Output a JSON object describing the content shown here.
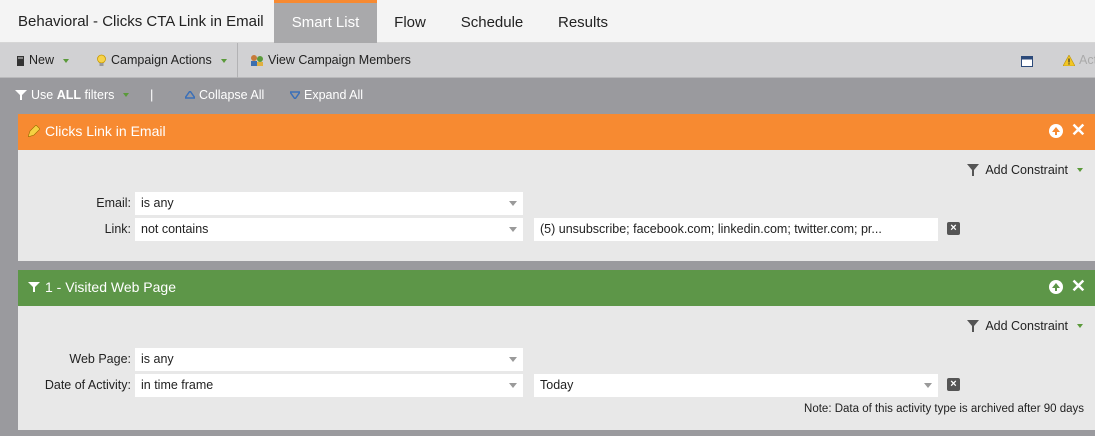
{
  "tabs": {
    "title": "Behavioral - Clicks CTA Link in Email",
    "items": [
      {
        "label": "Smart List",
        "active": true
      },
      {
        "label": "Flow",
        "active": false
      },
      {
        "label": "Schedule",
        "active": false
      },
      {
        "label": "Results",
        "active": false
      }
    ]
  },
  "toolbar": {
    "new_label": "New",
    "campaign_actions_label": "Campaign Actions",
    "view_members_label": "View Campaign Members",
    "alert_label": "Act"
  },
  "filterbar": {
    "use_prefix": "Use ",
    "use_strong": "ALL",
    "use_suffix": " filters",
    "separator": "|",
    "collapse_label": "Collapse All",
    "expand_label": "Expand All"
  },
  "filters": [
    {
      "title": "Clicks Link in Email",
      "color": "#f78a31",
      "add_constraint_label": "Add Constraint",
      "rows": [
        {
          "label": "Email:",
          "operator": "is any",
          "value": ""
        },
        {
          "label": "Link:",
          "operator": "not contains",
          "value": "(5) unsubscribe; facebook.com; linkedin.com; twitter.com; pr..."
        }
      ],
      "note": ""
    },
    {
      "title": "1 - Visited Web Page",
      "color": "#5d9648",
      "add_constraint_label": "Add Constraint",
      "rows": [
        {
          "label": "Web Page:",
          "operator": "is any",
          "value": ""
        },
        {
          "label": "Date of Activity:",
          "operator": "in time frame",
          "value": "Today"
        }
      ],
      "note": "Note: Data of this activity type is archived after 90 days"
    }
  ]
}
